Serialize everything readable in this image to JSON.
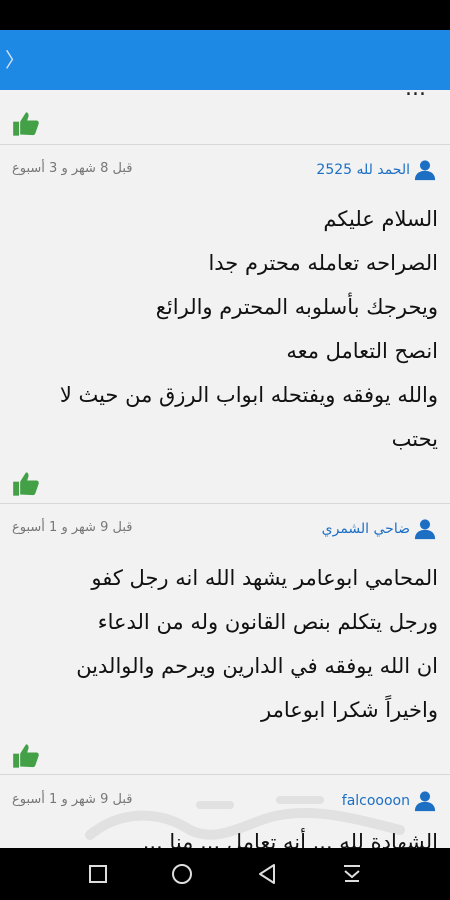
{
  "nav": {
    "back_icon": "chevron-left-icon"
  },
  "colors": {
    "app_bar": "#1e88e5",
    "username": "#1d6fc4",
    "thumb": "#43a047"
  },
  "previous_post_tail": "...",
  "posts": [
    {
      "username": "الحمد لله 2525",
      "time": "قبل 8 شهر و 3 أسبوع",
      "lines": [
        "السلام عليكم",
        "الصراحه تعامله محترم جدا",
        "ويحرجك بأسلوبه المحترم والرائع",
        "انصح التعامل معه",
        "والله يوفقه ويفتحله ابواب الرزق من حيث لا",
        "يحتب"
      ]
    },
    {
      "username": "ضاحي الشمري",
      "time": "قبل 9 شهر و 1 أسبوع",
      "lines": [
        "المحامي ابوعامر  يشهد الله انه رجل كفو",
        "ورجل يتكلم بنص القانون وله من الدعاء",
        "ان الله يوفقه في الدارين ويرحم والوالدين",
        "واخيراً شكرا ابوعامر"
      ]
    },
    {
      "username": "falcoooon",
      "time": "قبل 9 شهر و 1 أسبوع",
      "lines": [
        "الشهادة لله ... أنه تعامل ... منا ..."
      ]
    }
  ]
}
